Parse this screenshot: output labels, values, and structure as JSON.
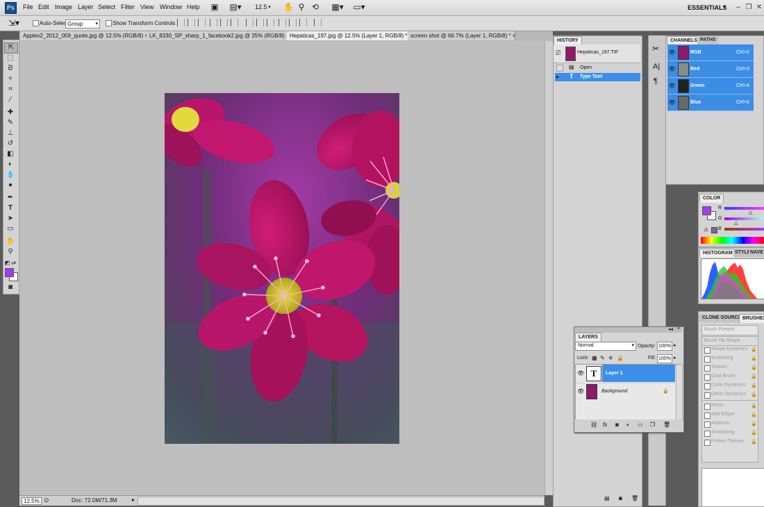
{
  "app": {
    "logo": "Ps"
  },
  "menu": [
    "File",
    "Edit",
    "Image",
    "Layer",
    "Select",
    "Filter",
    "View",
    "Window",
    "Help"
  ],
  "menubar": {
    "zoom_value": "12.5",
    "workspace": "ESSENTIALS"
  },
  "options": {
    "auto_select_label": "Auto-Select:",
    "auto_select_value": "Group",
    "transform_label": "Show Transform Controls"
  },
  "tabs": [
    {
      "label": "Apples2_2012_059_quote.jpg @ 12.5% (RGB/8)",
      "active": false
    },
    {
      "label": "LK_8330_SP_sharp_1_facebook2.jpg @ 25% (RGB/8)",
      "active": false
    },
    {
      "label": "Hepaticas_197.jpg @ 12.5% (Layer 1, RGB/8) *",
      "active": true
    },
    {
      "label": "screen shot @ 66.7% (Layer 1, RGB/8) *",
      "active": false
    }
  ],
  "status": {
    "zoom": "12.5%",
    "doc": "Doc: 72.0M/71.3M"
  },
  "history": {
    "tab": "HISTORY",
    "snapshot": "Hepaticas_197.TIF",
    "items": [
      {
        "label": "Open"
      },
      {
        "label": "Type Tool"
      }
    ]
  },
  "channels": {
    "tab_on": "CHANNELS",
    "tab_off": "PATHS",
    "rows": [
      {
        "name": "RGB",
        "shortcut": "Ctrl+2"
      },
      {
        "name": "Red",
        "shortcut": "Ctrl+3"
      },
      {
        "name": "Green",
        "shortcut": "Ctrl+4"
      },
      {
        "name": "Blue",
        "shortcut": "Ctrl+5"
      }
    ]
  },
  "color": {
    "tab": "COLOR",
    "labels": [
      "R",
      "G",
      "B"
    ],
    "foreground": "#a33cf0"
  },
  "histogram": {
    "tab_on": "HISTOGRAM",
    "tab_off": "STYLE",
    "tab_off2": "NAVE"
  },
  "brushes": {
    "tab_off": "CLONE SOURCE",
    "tab_on": "BRUSHES",
    "presets": "Brush Presets",
    "tip": "Brush Tip Shape",
    "options": [
      "Shape Dynamics",
      "Scattering",
      "Texture",
      "Dual Brush",
      "Color Dynamics",
      "Other Dynamics",
      "Noise",
      "Wet Edges",
      "Airbrush",
      "Smoothing",
      "Protect Texture"
    ]
  },
  "layers": {
    "tab": "LAYERS",
    "blend": "Normal",
    "opacity_label": "Opacity:",
    "opacity": "100%",
    "lock_label": "Lock:",
    "fill_label": "Fill:",
    "fill": "100%",
    "items": [
      {
        "name": "Layer 1",
        "type": "text"
      },
      {
        "name": "Background",
        "type": "image"
      }
    ]
  },
  "colors": {
    "accent": "#3d8ee8",
    "canvas_bg": "#bebebe"
  }
}
